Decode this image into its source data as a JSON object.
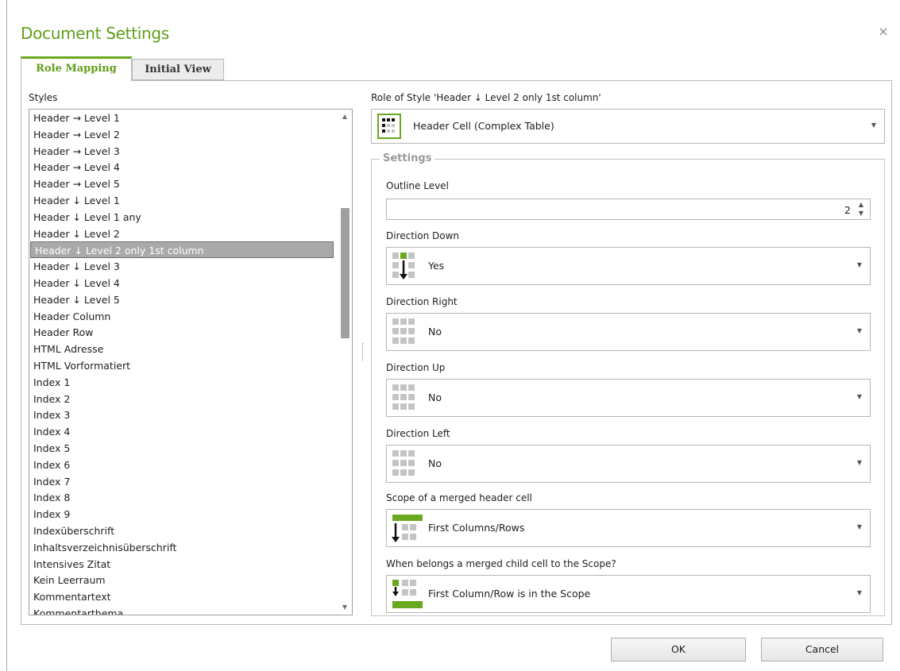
{
  "dialog": {
    "title": "Document Settings",
    "close": "×"
  },
  "tabs": [
    {
      "label": "Role Mapping"
    },
    {
      "label": "Initial View"
    }
  ],
  "styles": {
    "label": "Styles",
    "items": [
      "Header → Level 1",
      "Header → Level 2",
      "Header → Level 3",
      "Header → Level 4",
      "Header → Level 5",
      "Header ↓ Level 1",
      "Header ↓ Level 1 any",
      "Header ↓ Level 2",
      "Header ↓ Level 2 only 1st column",
      "Header ↓ Level 3",
      "Header ↓ Level 4",
      "Header ↓ Level 5",
      "Header Column",
      "Header Row",
      "HTML Adresse",
      "HTML Vorformatiert",
      "Index 1",
      "Index 2",
      "Index 3",
      "Index 4",
      "Index 5",
      "Index 6",
      "Index 7",
      "Index 8",
      "Index 9",
      "Indexüberschrift",
      "Inhaltsverzeichnisüberschrift",
      "Intensives Zitat",
      "Kein Leerraum",
      "Kommentartext",
      "Kommentarthema"
    ],
    "selected_index": 8
  },
  "role": {
    "label": "Role of Style 'Header ↓ Level 2 only 1st column'",
    "value": "Header Cell (Complex Table)"
  },
  "settings": {
    "legend": "Settings",
    "outline_level": {
      "label": "Outline Level",
      "value": "2"
    },
    "direction_down": {
      "label": "Direction Down",
      "value": "Yes"
    },
    "direction_right": {
      "label": "Direction Right",
      "value": "No"
    },
    "direction_up": {
      "label": "Direction Up",
      "value": "No"
    },
    "direction_left": {
      "label": "Direction Left",
      "value": "No"
    },
    "scope": {
      "label": "Scope of a merged header cell",
      "value": "First Columns/Rows"
    },
    "child_scope": {
      "label": "When belongs a merged child cell to the Scope?",
      "value": "First Column/Row is in the Scope"
    }
  },
  "buttons": {
    "ok": "OK",
    "cancel": "Cancel"
  },
  "colors": {
    "accent": "#5f9e17",
    "icon_green": "#6aa820",
    "icon_gray": "#c4c4c4",
    "selection": "#a9a9a9"
  }
}
